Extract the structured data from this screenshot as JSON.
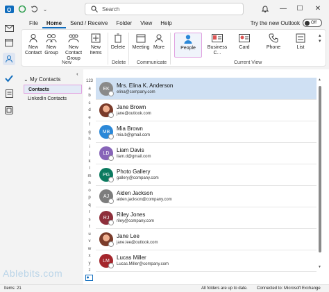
{
  "titlebar": {
    "search_placeholder": "Search",
    "colors": {
      "outlook_blue": "#0f6cbd",
      "sync_green": "#2e9e4f"
    },
    "icons": [
      "outlook-icon",
      "sync-icon",
      "undo-icon",
      "bell-icon",
      "minimize-icon",
      "maximize-icon",
      "close-icon"
    ]
  },
  "menubar": {
    "tabs": [
      {
        "label": "File"
      },
      {
        "label": "Home"
      },
      {
        "label": "Send / Receive"
      },
      {
        "label": "Folder"
      },
      {
        "label": "View"
      },
      {
        "label": "Help"
      }
    ],
    "active_tab": "Home",
    "new_outlook_label": "Try the new Outlook",
    "toggle_label": "Off"
  },
  "ribbon": {
    "new_contact": "New Contact",
    "new_group": "New Group",
    "new_contact_group": "New Contact Group",
    "new_items": "New Items",
    "delete": "Delete",
    "meeting": "Meeting",
    "more": "More",
    "people": "People",
    "business_card": "Business C...",
    "card": "Card",
    "phone": "Phone",
    "list": "List",
    "groups": {
      "new": "New",
      "delete": "Delete",
      "communicate": "Communicate",
      "current_view": "Current View"
    }
  },
  "folder_pane": {
    "header": "My Contacts",
    "items": [
      {
        "label": "Contacts",
        "selected": true
      },
      {
        "label": "LinkedIn Contacts",
        "selected": false
      }
    ]
  },
  "alpha_index": [
    "123",
    "a",
    "b",
    "c",
    "d",
    "e",
    "f",
    "g",
    "h",
    "i",
    "j",
    "k",
    "l",
    "m",
    "n",
    "o",
    "p",
    "q",
    "r",
    "s",
    "t",
    "u",
    "v",
    "w",
    "x",
    "y",
    "z"
  ],
  "contacts": [
    {
      "name": "Mrs. Elina K. Anderson",
      "email": "elina@company.com",
      "initials": "EK",
      "color": "#8a8a8a",
      "selected": true
    },
    {
      "name": "Jane Brown",
      "email": "jane@outlook.com",
      "initials": "",
      "color": "#7a3b2a",
      "photo": true
    },
    {
      "name": "Mia Brown",
      "email": "mia.b@gmail.com",
      "initials": "MB",
      "color": "#2b88d8"
    },
    {
      "name": "Liam Davis",
      "email": "liam.d@gmail.com",
      "initials": "LD",
      "color": "#8764b8"
    },
    {
      "name": "Photo Gallery",
      "email": "gallery@company.com",
      "initials": "PG",
      "color": "#0b7a5f"
    },
    {
      "name": "Aiden Jackson",
      "email": "aiden.jackson@company.com",
      "initials": "AJ",
      "color": "#7d7d7d"
    },
    {
      "name": "Riley Jones",
      "email": "riley@company.com",
      "initials": "RJ",
      "color": "#8e2f3b"
    },
    {
      "name": "Jane Lee",
      "email": "jane.lee@outlook.com",
      "initials": "",
      "color": "#5a3a22",
      "photo": true
    },
    {
      "name": "Lucas Miller",
      "email": "Lucas.Miller@company.com",
      "initials": "LM",
      "color": "#a4262c"
    }
  ],
  "watermark": "Ablebits.com",
  "status": {
    "items": "Items: 21",
    "folders": "All folders are up to date.",
    "connection": "Connected to: Microsoft Exchange"
  }
}
